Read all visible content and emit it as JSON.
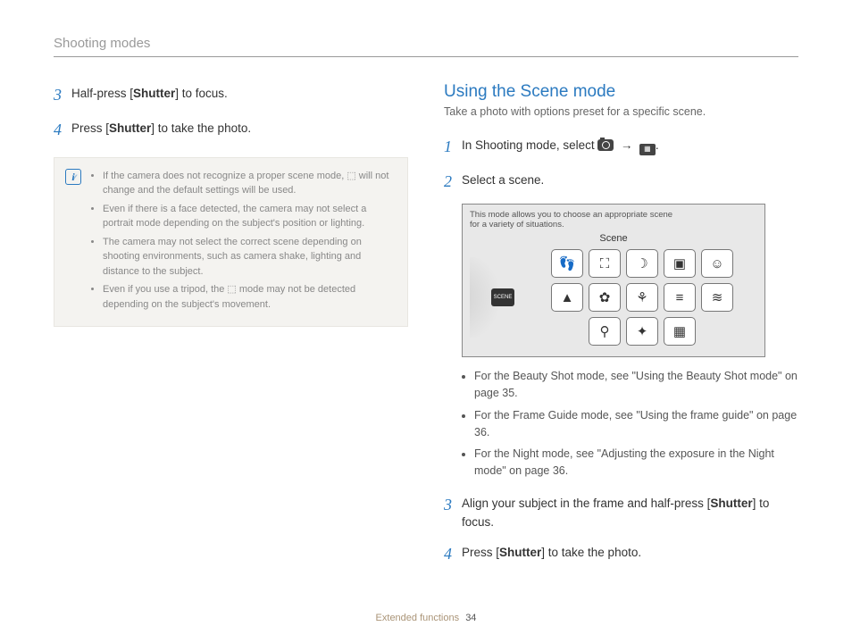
{
  "header": "Shooting modes",
  "left": {
    "steps": [
      {
        "num": "3",
        "pre": "Half-press [",
        "bold": "Shutter",
        "post": "] to focus."
      },
      {
        "num": "4",
        "pre": "Press [",
        "bold": "Shutter",
        "post": "] to take the photo."
      }
    ],
    "notes": [
      "If the camera does not recognize a proper scene mode, ⬚ will not change and the default settings will be used.",
      "Even if there is a face detected, the camera may not select a portrait mode depending on the subject's position or lighting.",
      "The camera may not select the correct scene depending on shooting environments, such as camera shake, lighting and distance to the subject.",
      "Even if you use a tripod, the ⬚ mode may not be detected depending on the subject's movement."
    ]
  },
  "right": {
    "heading": "Using the Scene mode",
    "sub": "Take a photo with options preset for a specific scene.",
    "steps12": [
      {
        "num": "1",
        "text": "In Shooting mode, select",
        "tail": "."
      },
      {
        "num": "2",
        "text": "Select a scene.",
        "tail": ""
      }
    ],
    "screen": {
      "note": "This mode allows you to choose an appropriate scene for a variety of situations.",
      "title": "Scene",
      "dial_label": "SCENE",
      "tiles": [
        "👣",
        "⛶",
        "☽",
        "▣",
        "☺",
        "▲",
        "✿",
        "⚘",
        "≡",
        "≋",
        "⚲",
        "✦",
        "▦"
      ]
    },
    "refs": [
      "For the Beauty Shot mode, see \"Using the Beauty Shot mode\" on page 35.",
      "For the Frame Guide mode, see \"Using the frame guide\" on page 36.",
      "For the Night mode, see \"Adjusting the exposure in the Night mode\" on page 36."
    ],
    "steps34": [
      {
        "num": "3",
        "pre": "Align your subject in the frame and half-press [",
        "bold": "Shutter",
        "post": "] to focus."
      },
      {
        "num": "4",
        "pre": "Press [",
        "bold": "Shutter",
        "post": "] to take the photo."
      }
    ]
  },
  "footer": {
    "section": "Extended functions",
    "page": "34"
  }
}
